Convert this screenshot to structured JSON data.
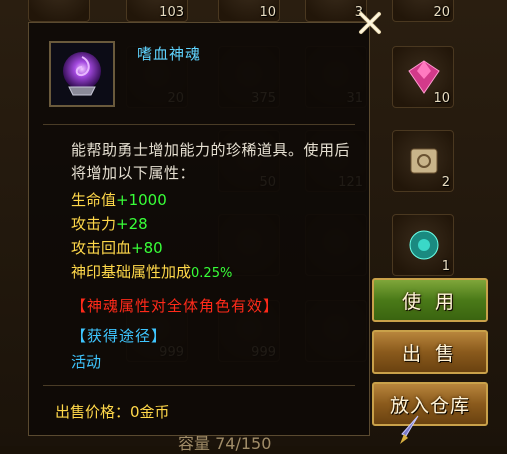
{
  "item": {
    "name": "嗜血神魂",
    "description": "能帮助勇士增加能力的珍稀道具。使用后将增加以下属性：",
    "attributes": [
      {
        "label": "生命值",
        "value": "+1000"
      },
      {
        "label": "攻击力",
        "value": "+28"
      },
      {
        "label": "攻击回血",
        "value": "+80"
      },
      {
        "label": "神印基础属性加成",
        "value": "0.25%"
      }
    ],
    "notice": "【神魂属性对全体角色有效】",
    "source_title": "【获得途径】",
    "source_value": "活动",
    "price": "出售价格：0金币",
    "icon": "purple-soul-orb-icon"
  },
  "buttons": {
    "use": "使 用",
    "sell": "出 售",
    "store": "放入仓库"
  },
  "inventory": {
    "capacity": "容量 74/150",
    "slots": [
      {
        "qty": "103"
      },
      {
        "qty": "10"
      },
      {
        "qty": "3"
      },
      {
        "qty": "20"
      },
      {
        "qty": "20"
      },
      {
        "qty": "375"
      },
      {
        "qty": "31"
      },
      {
        "qty": "10"
      },
      {
        "qty": "50"
      },
      {
        "qty": "121"
      },
      {
        "qty": "2"
      },
      {
        "qty": "1"
      },
      {
        "qty": "999"
      },
      {
        "qty": "999"
      }
    ]
  },
  "colors": {
    "name": "#5fd4ff",
    "attr_label": "#ffd84a",
    "attr_value": "#38ff38",
    "notice": "#ff2a1a",
    "source": "#3fc6ff",
    "use_button": "#4a7a18",
    "sell_button": "#8a5a1c"
  }
}
